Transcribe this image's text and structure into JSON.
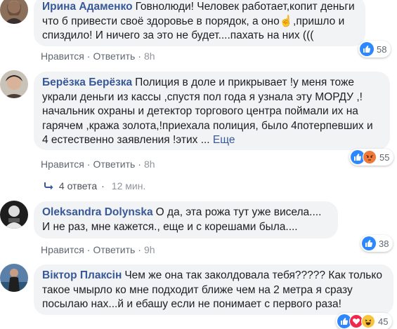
{
  "common": {
    "like_label": "Нравится",
    "reply_label": "Ответить",
    "sep": "·"
  },
  "comments": [
    {
      "author": "Ирина Адаменко",
      "text": "Говнолюди! Человек работает,копит деньги что б привести своё здоровье в порядок, а оно☝️,пришло и спиздило! И ничего за это не будет....пахать на них (((",
      "time": "8h",
      "reactions": [
        "like"
      ],
      "reaction_count": "58"
    },
    {
      "author": "Берёзка Берёзка",
      "text": "Полиция в доле и прикрывает !у меня тоже украли деньги из кассы ,спустя пол года я узнала эту МОРДУ ,! начальник охраны и детектор торгового центра поймали их на гарячем ,кража золота,!приехала полиция, было 4потерпевших и 4 естественно заявления !этих ...",
      "more": "Еще",
      "time": "8h",
      "reactions": [
        "like",
        "angry"
      ],
      "reaction_count": "55",
      "replies": {
        "count_label": "4 ответа",
        "time": "12 мин."
      }
    },
    {
      "author": "Oleksandra Dolynska",
      "text": "О да, эта рожа тут уже висела.... И не раз, мне кажется., еще и с корешами была....",
      "time": "9h",
      "reactions": [
        "like"
      ],
      "reaction_count": "38"
    },
    {
      "author": "Віктор Плаксін",
      "text": "Чем же она так заколдовала тебя????? Как только такое чмырло ко мне подходит ближе чем на 2 метра я сразу посылаю нах...й и ебашу если не понимает с первого раза!",
      "time": "9h",
      "reactions": [
        "like",
        "heart",
        "haha"
      ],
      "reaction_count": "45"
    }
  ],
  "colors": {
    "author": "#385898",
    "bubble": "#f2f3f5",
    "meta": "#606770",
    "like": "#2d88ff"
  }
}
